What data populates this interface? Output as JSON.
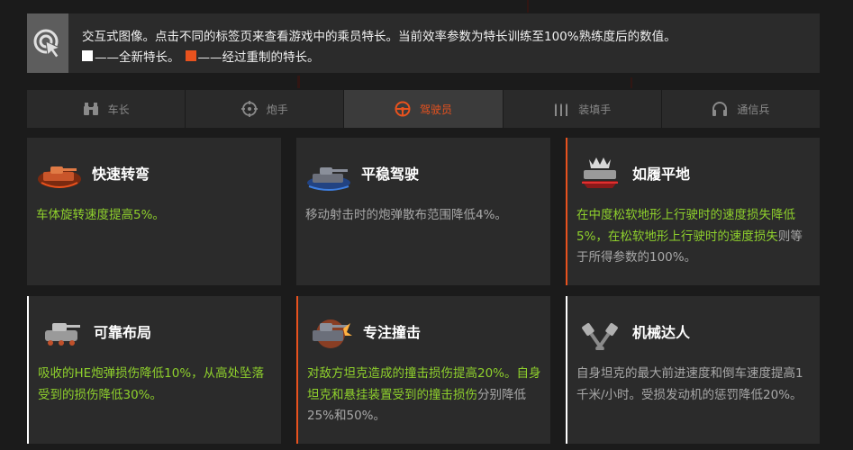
{
  "info": {
    "line1": "交互式图像。点击不同的标签页来查看游戏中的乘员特长。当前效率参数为特长训练至100%熟练度后的数值。",
    "legend_new": "——全新特长。",
    "legend_reworked": "——经过重制的特长。"
  },
  "tabs": [
    {
      "label": "车长",
      "icon": "binoculars-icon",
      "active": false
    },
    {
      "label": "炮手",
      "icon": "crosshair-icon",
      "active": false
    },
    {
      "label": "驾驶员",
      "icon": "steering-wheel-icon",
      "active": true
    },
    {
      "label": "装填手",
      "icon": "shells-icon",
      "active": false
    },
    {
      "label": "通信兵",
      "icon": "headphones-icon",
      "active": false
    }
  ],
  "cards": [
    {
      "title": "快速转弯",
      "icon": "tank-turning-icon",
      "desc": [
        {
          "t": "车体旋转速度提高5%。",
          "g": true
        }
      ]
    },
    {
      "title": "平稳驾驶",
      "icon": "tank-smooth-ride-icon",
      "desc": [
        {
          "t": "移动射击时的炮弹散布范围降低4%。",
          "g": false
        }
      ]
    },
    {
      "title": "如履平地",
      "icon": "tank-off-road-icon",
      "desc": [
        {
          "t": "在中度松软地形上行驶时的速度损失降低5%，在松软地形上行驶时的速度损失",
          "g": true
        },
        {
          "t": "则等于所得参数的100%。",
          "g": false
        }
      ]
    },
    {
      "title": "可靠布局",
      "icon": "tank-armor-layout-icon",
      "desc": [
        {
          "t": "吸收的HE炮弹损伤降低10%，从高处坠落受到的损伤降低30%。",
          "g": true
        }
      ]
    },
    {
      "title": "专注撞击",
      "icon": "tank-ramming-icon",
      "desc": [
        {
          "t": "对敌方坦克造成的撞击损伤提高20%。自身坦克和悬挂装置受到的撞击损伤",
          "g": true
        },
        {
          "t": "分别降低25%和50%。",
          "g": false
        }
      ]
    },
    {
      "title": "机械达人",
      "icon": "pistons-icon",
      "desc": [
        {
          "t": "自身坦克的最大前进速度和倒车速度提高1千米/小时。受损发动机的惩罚降低20%。",
          "g": false
        }
      ]
    }
  ],
  "colors": {
    "accent": "#e8521e",
    "green": "#8fd12c",
    "new_marker": "#ffffff"
  }
}
